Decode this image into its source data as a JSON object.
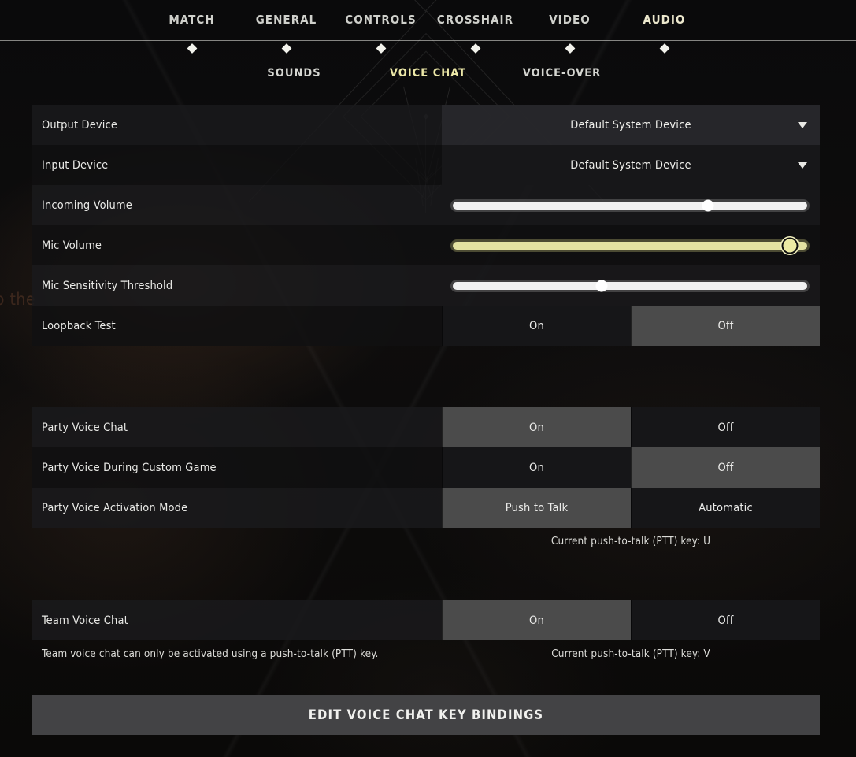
{
  "nav": {
    "tabs": [
      {
        "label": "MATCH",
        "active": false
      },
      {
        "label": "GENERAL",
        "active": false
      },
      {
        "label": "CONTROLS",
        "active": false
      },
      {
        "label": "CROSSHAIR",
        "active": false
      },
      {
        "label": "VIDEO",
        "active": false
      },
      {
        "label": "AUDIO",
        "active": true
      }
    ]
  },
  "subnav": {
    "tabs": [
      {
        "label": "SOUNDS",
        "active": false
      },
      {
        "label": "VOICE CHAT",
        "active": true
      },
      {
        "label": "VOICE-OVER",
        "active": false
      }
    ]
  },
  "background": {
    "ghost_text": "to the"
  },
  "group1": {
    "rows": [
      {
        "label": "Output Device",
        "type": "dropdown",
        "value": "Default System Device",
        "icon": "chevron-down-icon"
      },
      {
        "label": "Input Device",
        "type": "dropdown",
        "value": "Default System Device",
        "icon": "chevron-down-icon"
      },
      {
        "label": "Incoming Volume",
        "type": "slider",
        "percent": 72,
        "highlighted": false
      },
      {
        "label": "Mic Volume",
        "type": "slider",
        "percent": 95,
        "highlighted": true
      },
      {
        "label": "Mic Sensitivity Threshold",
        "type": "slider",
        "percent": 42,
        "highlighted": false
      },
      {
        "label": "Loopback Test",
        "type": "segmented",
        "options": [
          "On",
          "Off"
        ],
        "selected": 1
      }
    ]
  },
  "group2": {
    "rows": [
      {
        "label": "Party Voice Chat",
        "type": "segmented",
        "options": [
          "On",
          "Off"
        ],
        "selected": 0
      },
      {
        "label": "Party Voice During Custom Game",
        "type": "segmented",
        "options": [
          "On",
          "Off"
        ],
        "selected": 1
      },
      {
        "label": "Party Voice Activation Mode",
        "type": "segmented",
        "options": [
          "Push to Talk",
          "Automatic"
        ],
        "selected": 0
      }
    ],
    "note_right": "Current push-to-talk (PTT) key: U"
  },
  "group3": {
    "rows": [
      {
        "label": "Team Voice Chat",
        "type": "segmented",
        "options": [
          "On",
          "Off"
        ],
        "selected": 0
      }
    ],
    "note_left": "Team voice chat can only be activated using a push-to-talk (PTT) key.",
    "note_right": "Current push-to-talk (PTT) key: V"
  },
  "footer": {
    "edit_bindings_label": "EDIT VOICE CHAT KEY BINDINGS"
  },
  "colors": {
    "accent": "#ece8a8",
    "selected_segment": "#4b4b4b",
    "row_bg": "#1a1a1c",
    "row_bg_alt": "#101012"
  }
}
